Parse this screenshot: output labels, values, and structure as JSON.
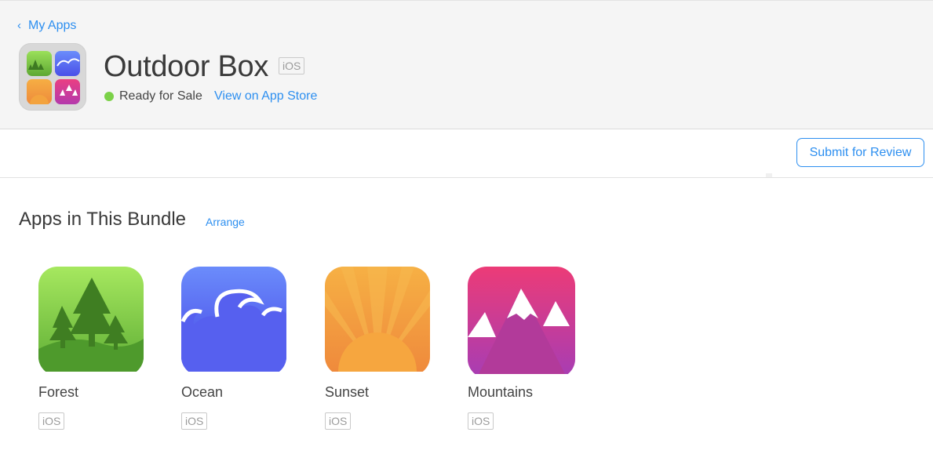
{
  "header": {
    "back_label": "My Apps",
    "app_name": "Outdoor Box",
    "platform": "iOS",
    "status_text": "Ready for Sale",
    "status_color": "#7bd148",
    "store_link": "View on App Store"
  },
  "toolbar": {
    "submit_label": "Submit for Review"
  },
  "bundle": {
    "title": "Apps in This Bundle",
    "arrange_label": "Arrange",
    "apps": [
      {
        "name": "Forest",
        "platform": "iOS",
        "icon": "forest-icon"
      },
      {
        "name": "Ocean",
        "platform": "iOS",
        "icon": "ocean-icon"
      },
      {
        "name": "Sunset",
        "platform": "iOS",
        "icon": "sunset-icon"
      },
      {
        "name": "Mountains",
        "platform": "iOS",
        "icon": "mountains-icon"
      }
    ]
  },
  "colors": {
    "accent": "#2d8ff0"
  }
}
